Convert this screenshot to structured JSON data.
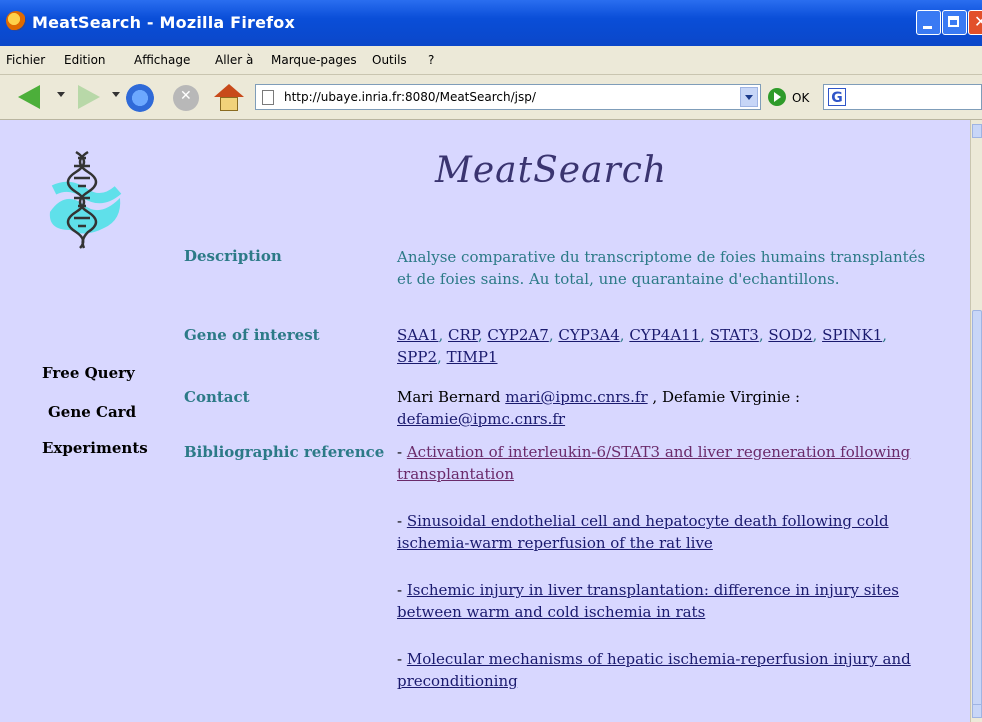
{
  "window": {
    "title": "MeatSearch - Mozilla Firefox"
  },
  "menu": [
    "Fichier",
    "Edition",
    "Affichage",
    "Aller à",
    "Marque-pages",
    "Outils",
    "?"
  ],
  "toolbar": {
    "url": "http://ubaye.inria.fr:8080/MeatSearch/jsp/",
    "go_label": "OK"
  },
  "page": {
    "title": "MeatSearch",
    "nav": [
      "Free Query",
      "Gene Card",
      "Experiments"
    ],
    "description": {
      "label": "Description",
      "text": "Analyse comparative du transcriptome de foies humains transplantés et de foies sains. Au total, une quarantaine d'echantillons."
    },
    "genes": {
      "label": "Gene of interest",
      "items": [
        "SAA1",
        "CRP",
        "CYP2A7",
        "CYP3A4",
        "CYP4A11",
        "STAT3",
        "SOD2",
        "SPINK1",
        "SPP2",
        "TIMP1"
      ]
    },
    "contact": {
      "label": "Contact",
      "name1": "Mari Bernard",
      "email1": "mari@ipmc.cnrs.fr",
      "name2": ", Defamie Virginie :",
      "email2": "defamie@ipmc.cnrs.fr"
    },
    "biblio": {
      "label": "Bibliographic reference",
      "items": [
        "Activation of interleukin-6/STAT3 and liver regeneration following transplantation",
        "Sinusoidal endothelial cell and hepatocyte death following cold ischemia-warm reperfusion of the rat live",
        " Ischemic injury in liver transplantation: difference in injury sites between warm and cold ischemia in rats",
        "Molecular mechanisms of hepatic ischemia-reperfusion injury and preconditioning"
      ]
    }
  }
}
